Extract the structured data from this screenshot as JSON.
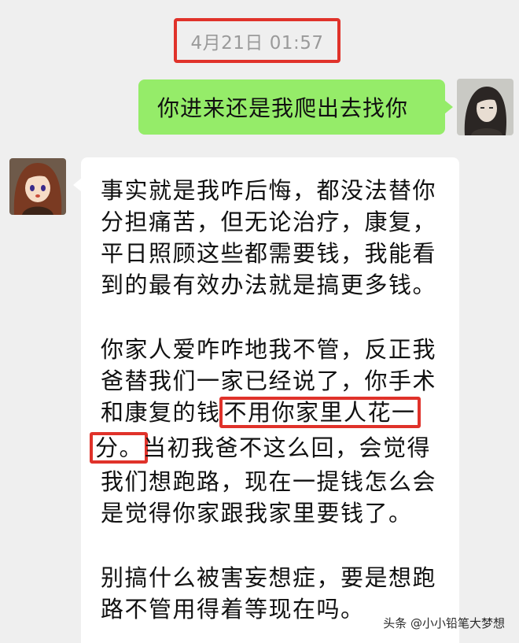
{
  "timestamp": "4月21日 01:57",
  "sent_message": "你进来还是我爬出去找你",
  "received_message": {
    "lines": [
      "事实就是我咋后悔，都没法替你",
      "分担痛苦，但无论治疗，康复，",
      "平日照顾这些都需要钱，我能看",
      "到的最有效办法就是搞更多钱。",
      "你家人爱咋咋地我不管，反正我",
      "爸替我们一家已经说了，你手术",
      "我们想跑路，现在一提钱怎么会",
      "是觉得你家跟我家里要钱了。",
      "别搞什么被害妄想症，要是想跑",
      "路不管用得着等现在吗。"
    ],
    "line7_plain": "和康复的钱",
    "line7_highlight": "不用你家里人花一",
    "line8_highlight": "分。",
    "line8_plain": "当初我爸不这么回，会觉得"
  },
  "watermark": "头条 @小小铅笔大梦想",
  "colors": {
    "background": "#efefef",
    "sent_bubble": "#95ec69",
    "received_bubble": "#ffffff",
    "highlight_border": "#e0322a",
    "timestamp_text": "#9a9a9a"
  }
}
